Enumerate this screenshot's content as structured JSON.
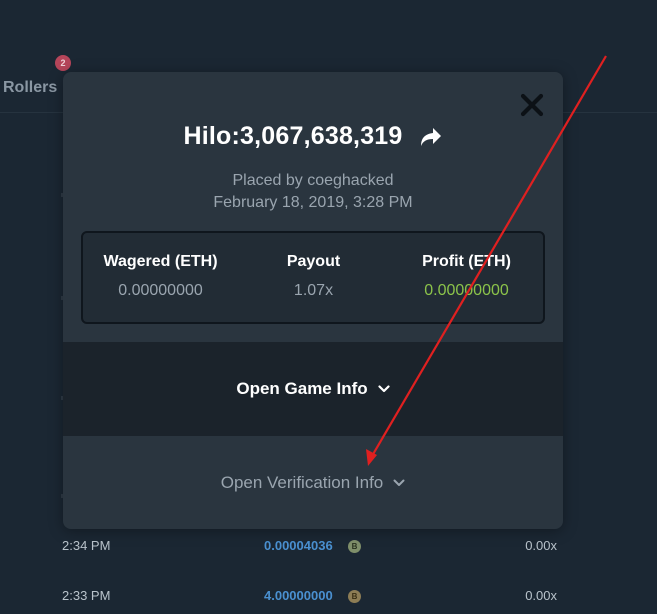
{
  "background": {
    "tab_label": "Rollers",
    "tab_badge": "2",
    "rows": [
      {
        "time": "2:34 PM",
        "amount": "0.00004036",
        "coin": "B",
        "multiplier": "0.00x"
      },
      {
        "time": "2:33 PM",
        "amount": "4.00000000",
        "coin": "B",
        "multiplier": "0.00x"
      }
    ]
  },
  "modal": {
    "title": "Hilo:3,067,638,319",
    "placed_by": "Placed by coeghacked",
    "date": "February 18, 2019, 3:28 PM",
    "stats": {
      "wagered_label": "Wagered (ETH)",
      "wagered_value": "0.00000000",
      "payout_label": "Payout",
      "payout_value": "1.07x",
      "profit_label": "Profit (ETH)",
      "profit_value": "0.00000000"
    },
    "game_info_label": "Open Game Info",
    "verification_info_label": "Open Verification Info"
  },
  "colors": {
    "profit": "#8bc34a",
    "annotation_arrow": "#e02020",
    "link_amount": "#4a90d0"
  },
  "icons": {
    "close": "close-icon",
    "share": "share-icon",
    "chevron": "chevron-down-icon"
  }
}
